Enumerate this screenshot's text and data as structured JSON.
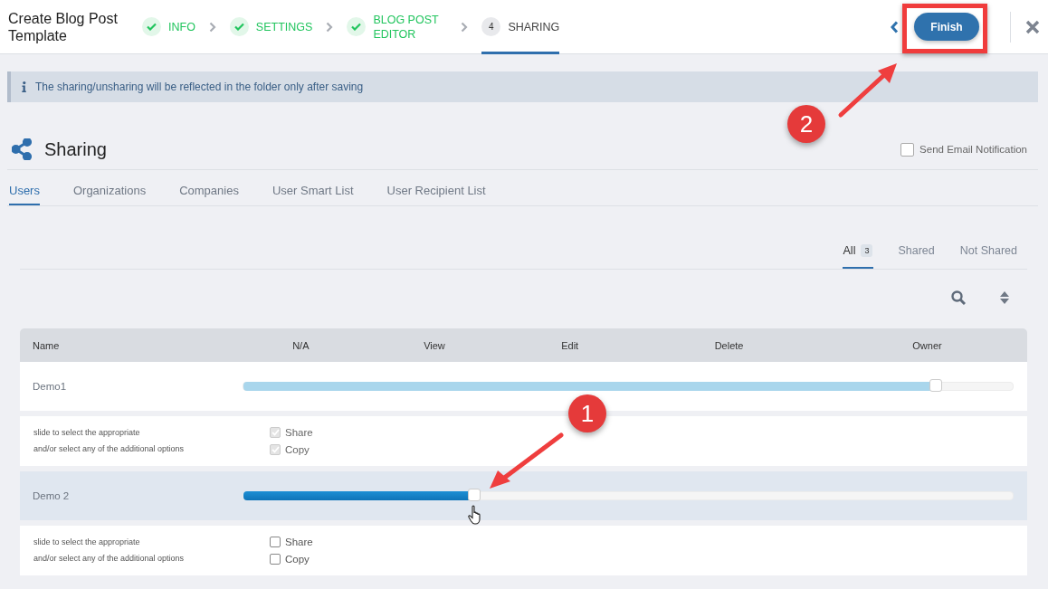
{
  "header": {
    "title": "Create Blog Post Template",
    "steps": [
      {
        "label": "INFO",
        "completed": true,
        "selected": false
      },
      {
        "label": "SETTINGS",
        "completed": true,
        "selected": false
      },
      {
        "label": "BLOG POST EDITOR",
        "completed": true,
        "selected": false
      },
      {
        "number": "4",
        "label": "SHARING",
        "completed": false,
        "selected": true
      }
    ],
    "finish_button": "Finish"
  },
  "info_banner": "The sharing/unsharing will be reflected in the folder only after saving",
  "sharing": {
    "title": "Sharing",
    "send_email_notification": {
      "label": "Send Email Notification",
      "checked": false
    },
    "tabs": [
      {
        "label": "Users",
        "selected": true
      },
      {
        "label": "Organizations",
        "selected": false
      },
      {
        "label": "Companies",
        "selected": false
      },
      {
        "label": "User Smart List",
        "selected": false
      },
      {
        "label": "User Recipient List",
        "selected": false
      }
    ],
    "filters": [
      {
        "label": "All",
        "count": "3",
        "selected": true
      },
      {
        "label": "Shared",
        "selected": false
      },
      {
        "label": "Not Shared",
        "selected": false
      }
    ],
    "table": {
      "columns": [
        "Name",
        "N/A",
        "View",
        "Edit",
        "Delete",
        "Owner"
      ],
      "rows": [
        {
          "name": "Demo1",
          "level": 0.9,
          "disabled": true,
          "highlighted": false,
          "hint_lines": [
            "slide to select the appropriate",
            "and/or select any of the additional options"
          ],
          "options": [
            {
              "label": "Share",
              "checked": true,
              "disabled": true
            },
            {
              "label": "Copy",
              "checked": true,
              "disabled": true
            }
          ]
        },
        {
          "name": "Demo 2",
          "level": 0.3,
          "disabled": false,
          "highlighted": true,
          "hint_lines": [
            "slide to select the appropriate",
            "and/or select any of the additional options"
          ],
          "options": [
            {
              "label": "Share",
              "checked": false,
              "disabled": false
            },
            {
              "label": "Copy",
              "checked": false,
              "disabled": false
            }
          ]
        }
      ]
    }
  },
  "callouts": [
    {
      "number": "1"
    },
    {
      "number": "2"
    }
  ]
}
